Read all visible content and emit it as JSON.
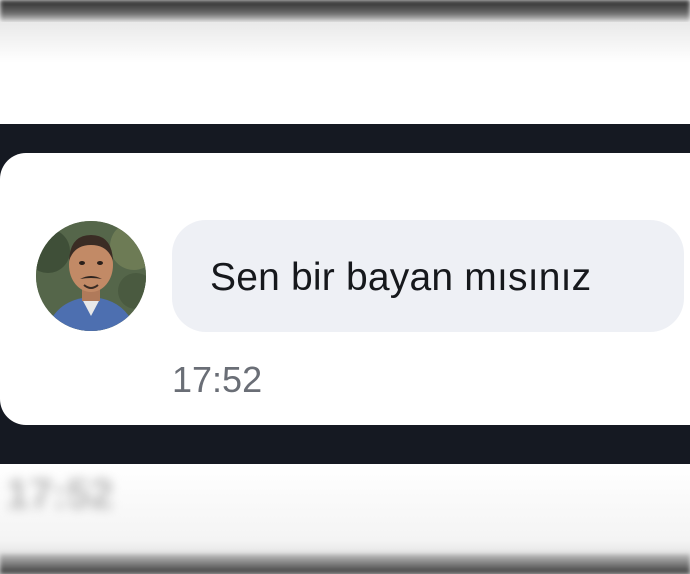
{
  "message": {
    "text": "Sen bir bayan mısınız",
    "time": "17:52"
  },
  "background": {
    "ghost_time": "17:52"
  },
  "colors": {
    "frame": "#151922",
    "bubble": "#eef0f5",
    "message_text": "#16181c",
    "timestamp_text": "#6a6e76"
  },
  "icons": {
    "avatar": "profile-photo"
  }
}
